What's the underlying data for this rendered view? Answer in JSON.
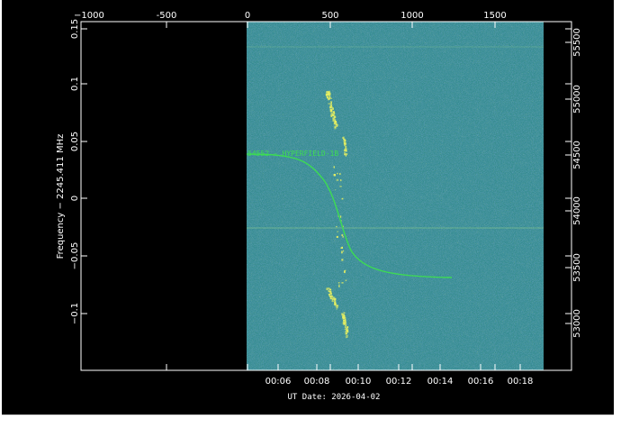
{
  "plot": {
    "top_axis": {
      "ticks": [
        "1000",
        "-500",
        "0",
        "500",
        "1000",
        "1500"
      ],
      "first_tick_prefix": "−"
    },
    "left_axis": {
      "label": "Frequency − 2245.411 MHz",
      "ticks": [
        "0.15",
        "0.1",
        "0.05",
        "0",
        "−0.05",
        "−0.1"
      ]
    },
    "right_axis": {
      "ticks": [
        "55500",
        "55000",
        "54500",
        "54000",
        "53500",
        "53000"
      ]
    },
    "bottom_axis": {
      "label": "UT Date: 2026-04-02",
      "ticks": [
        "00:06",
        "00:08",
        "00:10",
        "00:12",
        "00:14",
        "00:16",
        "00:18"
      ]
    },
    "trace_label": "54552 - HYPERFIELD-1B",
    "colors": {
      "background": "#000000",
      "spectrogram_base": "#2e8a8c",
      "noise_light": "#7fd0a0",
      "noise_dark": "#1f5a86",
      "signal": "#e8f060",
      "trace": "#3ddc52",
      "frame": "#ffffff"
    }
  }
}
